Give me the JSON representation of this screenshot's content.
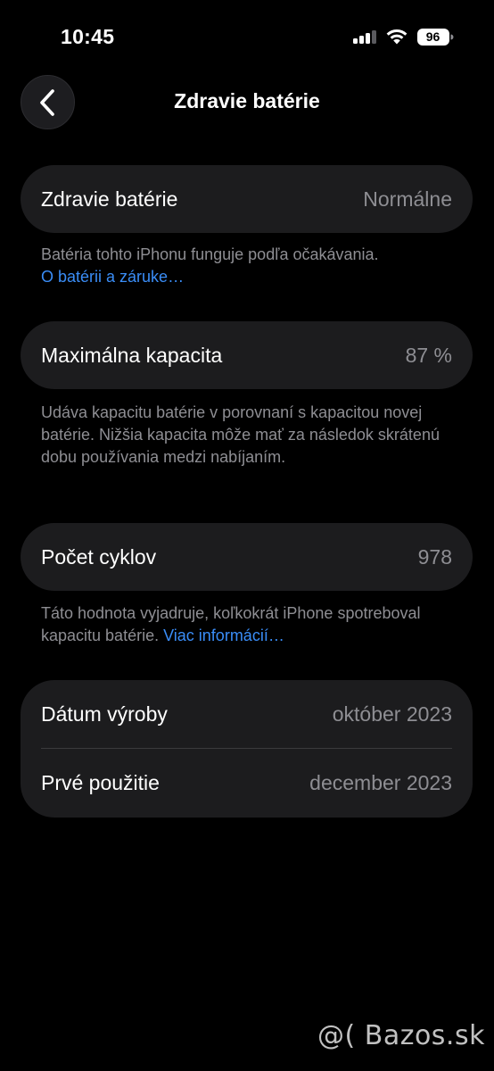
{
  "status_bar": {
    "time": "10:45",
    "battery_level": "96",
    "icons": [
      "cellular-signal-icon",
      "wifi-icon",
      "battery-icon"
    ]
  },
  "nav": {
    "title": "Zdravie batérie",
    "back_icon": "chevron-left-icon"
  },
  "battery_health": {
    "label": "Zdravie batérie",
    "value": "Normálne",
    "footnote": "Batéria tohto iPhonu funguje podľa očakávania.",
    "link": "O batérii a záruke…"
  },
  "max_capacity": {
    "label": "Maximálna kapacita",
    "value": "87 %",
    "footnote": "Udáva kapacitu batérie v porovnaní s kapacitou novej batérie. Nižšia kapacita môže mať za následok skrátenú dobu používania medzi nabíjaním."
  },
  "cycle_count": {
    "label": "Počet cyklov",
    "value": "978",
    "footnote": "Táto hodnota vyjadruje, koľkokrát iPhone spotreboval kapacitu batérie.",
    "link": "Viac informácií…"
  },
  "dates": {
    "manufacture_label": "Dátum výroby",
    "manufacture_value": "október 2023",
    "first_use_label": "Prvé použitie",
    "first_use_value": "december 2023"
  },
  "watermark": "@( Bazos.sk",
  "colors": {
    "background": "#000000",
    "card": "#1c1c1e",
    "secondary_text": "#8e8e93",
    "link": "#3a8df7"
  }
}
